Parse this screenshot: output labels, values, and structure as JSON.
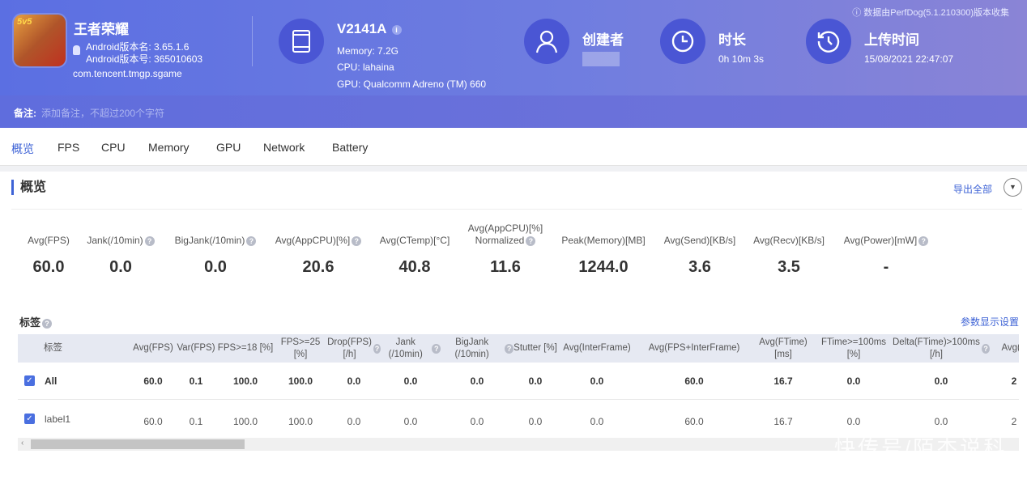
{
  "app": {
    "name": "王者荣耀",
    "version_name": "Android版本名: 3.65.1.6",
    "version_code": "Android版本号: 365010603",
    "package": "com.tencent.tmgp.sgame",
    "icon_text": "5v5"
  },
  "device": {
    "model": "V2141A",
    "memory": "Memory: 7.2G",
    "cpu": "CPU: lahaina",
    "gpu": "GPU: Qualcomm Adreno (TM) 660"
  },
  "creator": {
    "label": "创建者"
  },
  "duration": {
    "label": "时长",
    "value": "0h 10m 3s"
  },
  "upload": {
    "label": "上传时间",
    "value": "15/08/2021 22:47:07"
  },
  "collected_by": "数据由PerfDog(5.1.210300)版本收集",
  "note": {
    "label": "备注:",
    "placeholder": "添加备注，不超过200个字符"
  },
  "tabs": [
    "概览",
    "FPS",
    "CPU",
    "Memory",
    "GPU",
    "Network",
    "Battery"
  ],
  "overview": {
    "title": "概览",
    "export": "导出全部"
  },
  "stats": [
    {
      "label": "Avg(FPS)",
      "value": "60.0",
      "help": false
    },
    {
      "label": "Jank(/10min)",
      "value": "0.0",
      "help": true
    },
    {
      "label": "BigJank(/10min)",
      "value": "0.0",
      "help": true
    },
    {
      "label": "Avg(AppCPU)[%]",
      "value": "20.6",
      "help": true
    },
    {
      "label": "Avg(CTemp)[°C]",
      "value": "40.8",
      "help": false
    },
    {
      "label": "Avg(AppCPU)[%] Normalized",
      "value": "11.6",
      "help": true
    },
    {
      "label": "Peak(Memory)[MB]",
      "value": "1244.0",
      "help": false
    },
    {
      "label": "Avg(Send)[KB/s]",
      "value": "3.6",
      "help": false
    },
    {
      "label": "Avg(Recv)[KB/s]",
      "value": "3.5",
      "help": false
    },
    {
      "label": "Avg(Power)[mW]",
      "value": "-",
      "help": true
    }
  ],
  "labels": {
    "title": "标签",
    "settings": "参数显示设置",
    "columns": [
      "标签",
      "Avg(FPS)",
      "Var(FPS)",
      "FPS>=18 [%]",
      "FPS>=25 [%]",
      "Drop(FPS) [/h]",
      "Jank (/10min)",
      "BigJank (/10min)",
      "Stutter [%]",
      "Avg(InterFrame)",
      "Avg(FPS+InterFrame)",
      "Avg(FTime) [ms]",
      "FTime>=100ms [%]",
      "Delta(FTime)>100ms [/h]",
      "Avg(A"
    ],
    "rows": [
      {
        "name": "All",
        "checked": true,
        "values": [
          "60.0",
          "0.1",
          "100.0",
          "100.0",
          "0.0",
          "0.0",
          "0.0",
          "0.0",
          "0.0",
          "60.0",
          "16.7",
          "0.0",
          "0.0",
          "2"
        ]
      },
      {
        "name": "label1",
        "checked": true,
        "values": [
          "60.0",
          "0.1",
          "100.0",
          "100.0",
          "0.0",
          "0.0",
          "0.0",
          "0.0",
          "0.0",
          "60.0",
          "16.7",
          "0.0",
          "0.0",
          "2"
        ]
      }
    ]
  },
  "watermark": "快传号/陌杰说科技",
  "colors": {
    "accent": "#3e63d6",
    "header_start": "#5b6fe2",
    "header_end": "#8a84d6",
    "icon_circle": "#4a56d4"
  }
}
